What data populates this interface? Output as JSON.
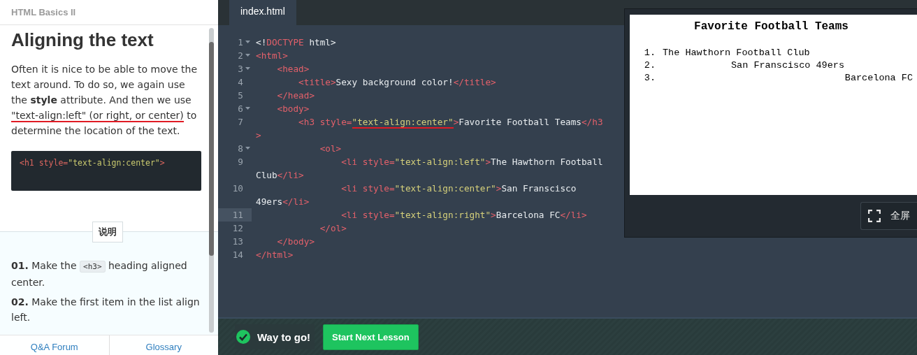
{
  "lesson": {
    "course": "HTML Basics II",
    "title": "Aligning the text",
    "paragraph": [
      {
        "text": "Often it is nice to be able to move the text around. To do so, we again use the **style** attribute. And then we use ",
        "marked": false
      },
      {
        "text": "\"text-align:left\" (or right, or center)",
        "marked": true
      },
      {
        "text": " to determine the location of the text.",
        "marked": false
      }
    ],
    "example": [
      {
        "kind": "tag",
        "text": "<h1 style="
      },
      {
        "kind": "string",
        "text": "\"text-align:center\""
      },
      {
        "kind": "tag",
        "text": ">"
      }
    ],
    "instructions_tab": "说明",
    "instructions": [
      {
        "number": "01.",
        "parts": [
          {
            "kind": "text",
            "text": "Make the "
          },
          {
            "kind": "code",
            "text": "<h3>"
          },
          {
            "kind": "text",
            "text": " heading aligned center."
          }
        ]
      },
      {
        "number": "02.",
        "parts": [
          {
            "kind": "text",
            "text": "Make the first item in the list align left."
          }
        ]
      }
    ],
    "footer_links": [
      "Q&A Forum",
      "Glossary"
    ]
  },
  "editor": {
    "tabs": [
      {
        "label": "index.html",
        "selected": true
      }
    ],
    "rows": [
      {
        "number": "1",
        "fold": true,
        "active": false,
        "tokens": [
          {
            "kind": "text",
            "text": "<!"
          },
          {
            "kind": "tag",
            "text": "DOCTYPE"
          },
          {
            "kind": "text",
            "text": " html>"
          }
        ]
      },
      {
        "number": "2",
        "fold": true,
        "active": false,
        "tokens": [
          {
            "kind": "tag",
            "text": "<html>"
          }
        ]
      },
      {
        "number": "3",
        "fold": true,
        "active": false,
        "tokens": [
          {
            "kind": "tag",
            "text": "    <head>"
          }
        ]
      },
      {
        "number": "4",
        "fold": false,
        "active": false,
        "tokens": [
          {
            "kind": "tag",
            "text": "        <title>"
          },
          {
            "kind": "text",
            "text": "Sexy background color!"
          },
          {
            "kind": "tag",
            "text": "</title>"
          }
        ]
      },
      {
        "number": "5",
        "fold": false,
        "active": false,
        "tokens": [
          {
            "kind": "tag",
            "text": "    </head>"
          }
        ]
      },
      {
        "number": "6",
        "fold": true,
        "active": false,
        "tokens": [
          {
            "kind": "tag",
            "text": "    <body>"
          }
        ]
      },
      {
        "number": "7",
        "fold": false,
        "active": false,
        "tokens": [
          {
            "kind": "tag",
            "text": "        <h3 style="
          },
          {
            "kind": "string",
            "text": "\"text-align:center\"",
            "marked": true
          },
          {
            "kind": "tag",
            "text": ">"
          },
          {
            "kind": "text",
            "text": "Favorite Football Teams"
          },
          {
            "kind": "tag",
            "text": "</h3"
          }
        ]
      },
      {
        "fold": false,
        "active": false,
        "tokens": [
          {
            "kind": "tag",
            "text": ">"
          }
        ]
      },
      {
        "number": "8",
        "fold": true,
        "active": false,
        "tokens": [
          {
            "kind": "tag",
            "text": "            <ol>"
          }
        ]
      },
      {
        "number": "9",
        "fold": false,
        "active": false,
        "tokens": [
          {
            "kind": "tag",
            "text": "                <li style="
          },
          {
            "kind": "string",
            "text": "\"text-align:left\""
          },
          {
            "kind": "tag",
            "text": ">"
          },
          {
            "kind": "text",
            "text": "The Hawthorn Football"
          }
        ]
      },
      {
        "fold": false,
        "active": false,
        "tokens": [
          {
            "kind": "text",
            "text": "Club"
          },
          {
            "kind": "tag",
            "text": "</li>"
          }
        ]
      },
      {
        "number": "10",
        "fold": false,
        "active": false,
        "tokens": [
          {
            "kind": "tag",
            "text": "                <li style="
          },
          {
            "kind": "string",
            "text": "\"text-align:center\""
          },
          {
            "kind": "tag",
            "text": ">"
          },
          {
            "kind": "text",
            "text": "San Franscisco"
          }
        ]
      },
      {
        "fold": false,
        "active": false,
        "tokens": [
          {
            "kind": "text",
            "text": "49ers"
          },
          {
            "kind": "tag",
            "text": "</li>"
          }
        ]
      },
      {
        "number": "11",
        "fold": false,
        "active": true,
        "tokens": [
          {
            "kind": "tag",
            "text": "                <li style="
          },
          {
            "kind": "string",
            "text": "\"text-align:right\""
          },
          {
            "kind": "tag",
            "text": ">"
          },
          {
            "kind": "text",
            "text": "Barcelona FC"
          },
          {
            "kind": "tag",
            "text": "</li>"
          }
        ]
      },
      {
        "number": "12",
        "fold": false,
        "active": false,
        "tokens": [
          {
            "kind": "tag",
            "text": "            </ol>"
          }
        ]
      },
      {
        "number": "13",
        "fold": false,
        "active": false,
        "tokens": [
          {
            "kind": "tag",
            "text": "    </body>"
          }
        ]
      },
      {
        "number": "14",
        "fold": false,
        "active": false,
        "tokens": [
          {
            "kind": "tag",
            "text": "</html>"
          }
        ]
      }
    ]
  },
  "preview": {
    "heading": "Favorite Football Teams",
    "items": [
      {
        "number": "1.",
        "text": "The Hawthorn Football Club",
        "kind": "left"
      },
      {
        "number": "2.",
        "text": "San Franscisco 49ers",
        "kind": "center"
      },
      {
        "number": "3.",
        "text": "Barcelona FC",
        "kind": "right"
      }
    ],
    "fullscreen_button": "全屏"
  },
  "status": {
    "message": "Way to go!",
    "next_button": "Start Next Lesson"
  }
}
